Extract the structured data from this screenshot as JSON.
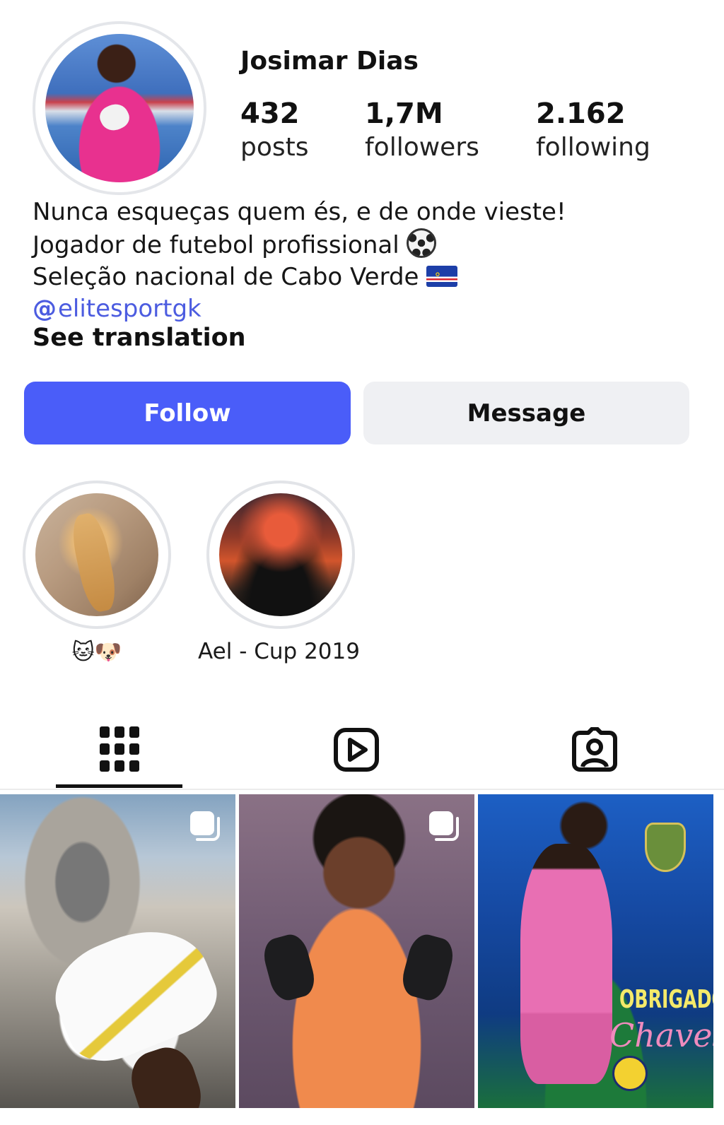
{
  "profile": {
    "name": "Josimar Dias",
    "stats": {
      "posts_count": "432",
      "posts_label": "posts",
      "followers_count": "1,7M",
      "followers_label": "followers",
      "following_count": "2.162",
      "following_label": "following"
    },
    "bio": {
      "line1": "Nunca esqueças quem és, e de onde vieste!",
      "line2": "Jogador de futebol profissional",
      "line3": "Seleção nacional de Cabo Verde",
      "link": "elitesportgk",
      "see_translation": "See translation"
    }
  },
  "actions": {
    "follow_label": "Follow",
    "message_label": "Message",
    "follow_color": "#4a5df9"
  },
  "highlights": [
    {
      "label": "🐱🐶"
    },
    {
      "label": "Ael - Cup 2019"
    }
  ],
  "tabs": {
    "icons": [
      "grid-icon",
      "reels-icon",
      "tagged-icon"
    ],
    "active": "grid"
  },
  "posts": [
    {
      "icon": "carousel-icon"
    },
    {
      "icon": "carousel-icon"
    },
    {
      "overlay_line1": "OBRIGADO!",
      "overlay_line2": "Chaves"
    }
  ]
}
